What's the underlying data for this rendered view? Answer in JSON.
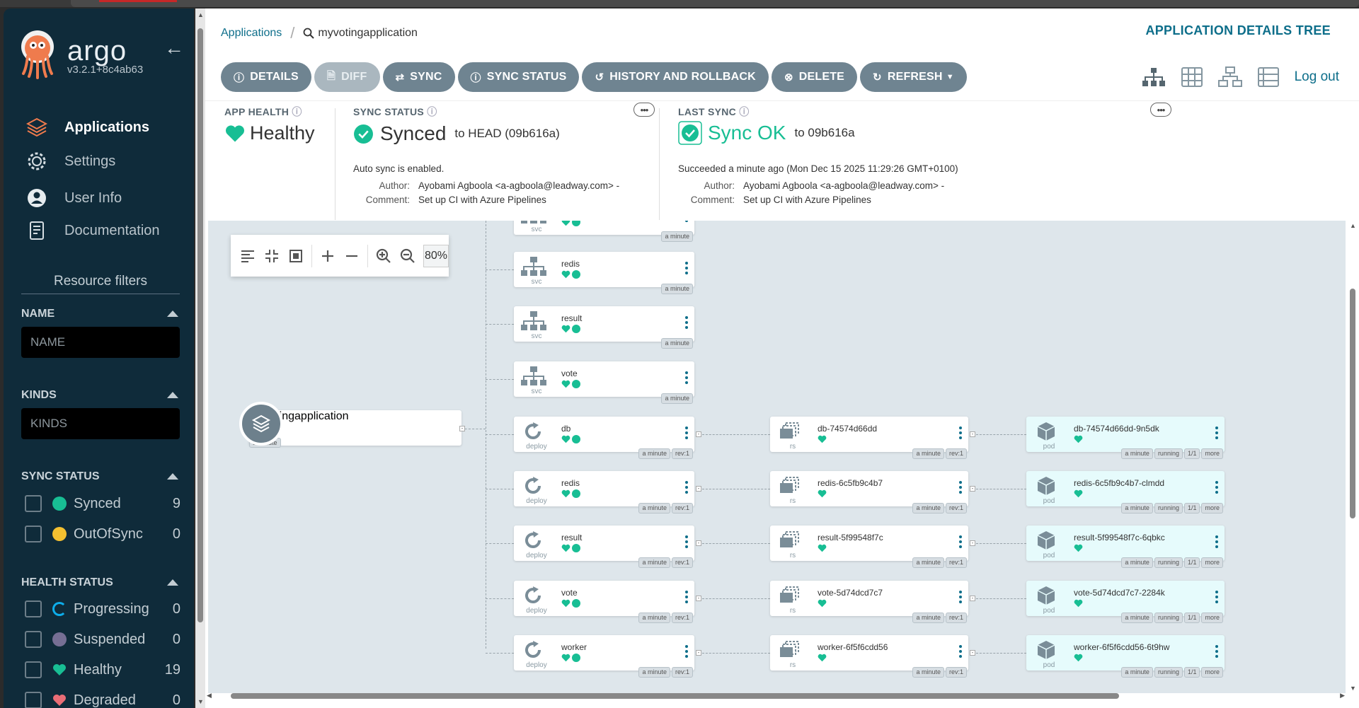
{
  "sidebar": {
    "logo_text": "argo",
    "version": "v3.2.1+8c4ab63",
    "nav": [
      {
        "label": "Applications"
      },
      {
        "label": "Settings"
      },
      {
        "label": "User Info"
      },
      {
        "label": "Documentation"
      }
    ],
    "resource_filters_title": "Resource filters",
    "name_section": {
      "title": "NAME",
      "placeholder": "NAME"
    },
    "kinds_section": {
      "title": "KINDS",
      "placeholder": "KINDS"
    },
    "sync_status": {
      "title": "SYNC STATUS",
      "items": [
        {
          "label": "Synced",
          "count": "9",
          "color": "#18be94"
        },
        {
          "label": "OutOfSync",
          "count": "0",
          "color": "#f4c030"
        }
      ]
    },
    "health_status": {
      "title": "HEALTH STATUS",
      "items": [
        {
          "label": "Progressing",
          "count": "0",
          "color": "#0dadea"
        },
        {
          "label": "Suspended",
          "count": "0",
          "color": "#766f94"
        },
        {
          "label": "Healthy",
          "count": "19",
          "color": "#18be94"
        },
        {
          "label": "Degraded",
          "count": "0",
          "color": "#e96d76"
        }
      ]
    }
  },
  "header": {
    "breadcrumb_root": "Applications",
    "breadcrumb_current": "myvotingapplication",
    "title": "APPLICATION DETAILS TREE",
    "logout": "Log out"
  },
  "toolbar": {
    "details": "DETAILS",
    "diff": "DIFF",
    "sync": "SYNC",
    "sync_status": "SYNC STATUS",
    "history": "HISTORY AND ROLLBACK",
    "delete": "DELETE",
    "refresh": "REFRESH"
  },
  "status": {
    "app_health_label": "APP HEALTH",
    "app_health_value": "Healthy",
    "sync_status_label": "SYNC STATUS",
    "sync_status_value": "Synced",
    "sync_target": "to HEAD (09b616a)",
    "auto_sync": "Auto sync is enabled.",
    "author_key": "Author:",
    "author_value": "Ayobami Agboola <a-agboola@leadway.com> -",
    "comment_key": "Comment:",
    "comment_value": "Set up CI with Azure Pipelines",
    "last_sync_label": "LAST SYNC",
    "last_sync_value": "Sync OK",
    "last_sync_target": "to 09b616a",
    "last_sync_time": "Succeeded a minute ago (Mon Dec 15 2025 11:29:26 GMT+0100)",
    "last_author_value": "Ayobami Agboola <a-agboola@leadway.com> -",
    "last_comment_value": "Set up CI with Azure Pipelines"
  },
  "graph": {
    "zoom": "80%",
    "app_node": {
      "name": "myvotingapplication",
      "age": "a minute"
    },
    "svc_nodes": [
      {
        "name": "",
        "type": "svc",
        "age": "a minute"
      },
      {
        "name": "redis",
        "type": "svc",
        "age": "a minute"
      },
      {
        "name": "result",
        "type": "svc",
        "age": "a minute"
      },
      {
        "name": "vote",
        "type": "svc",
        "age": "a minute"
      }
    ],
    "deploy_nodes": [
      {
        "name": "db",
        "type": "deploy",
        "age": "a minute",
        "rev": "rev:1"
      },
      {
        "name": "redis",
        "type": "deploy",
        "age": "a minute",
        "rev": "rev:1"
      },
      {
        "name": "result",
        "type": "deploy",
        "age": "a minute",
        "rev": "rev:1"
      },
      {
        "name": "vote",
        "type": "deploy",
        "age": "a minute",
        "rev": "rev:1"
      },
      {
        "name": "worker",
        "type": "deploy",
        "age": "a minute",
        "rev": "rev:1"
      }
    ],
    "rs_nodes": [
      {
        "name": "db-74574d66dd",
        "type": "rs",
        "age": "a minute",
        "rev": "rev:1"
      },
      {
        "name": "redis-6c5fb9c4b7",
        "type": "rs",
        "age": "a minute",
        "rev": "rev:1"
      },
      {
        "name": "result-5f99548f7c",
        "type": "rs",
        "age": "a minute",
        "rev": "rev:1"
      },
      {
        "name": "vote-5d74dcd7c7",
        "type": "rs",
        "age": "a minute",
        "rev": "rev:1"
      },
      {
        "name": "worker-6f5f6cdd56",
        "type": "rs",
        "age": "a minute",
        "rev": "rev:1"
      }
    ],
    "pod_nodes": [
      {
        "name": "db-74574d66dd-9n5dk",
        "type": "pod",
        "age": "a minute",
        "state": "running",
        "ready": "1/1",
        "more": "more"
      },
      {
        "name": "redis-6c5fb9c4b7-clmdd",
        "type": "pod",
        "age": "a minute",
        "state": "running",
        "ready": "1/1",
        "more": "more"
      },
      {
        "name": "result-5f99548f7c-6qbkc",
        "type": "pod",
        "age": "a minute",
        "state": "running",
        "ready": "1/1",
        "more": "more"
      },
      {
        "name": "vote-5d74dcd7c7-2284k",
        "type": "pod",
        "age": "a minute",
        "state": "running",
        "ready": "1/1",
        "more": "more"
      },
      {
        "name": "worker-6f5f6cdd56-6t9hw",
        "type": "pod",
        "age": "a minute",
        "state": "running",
        "ready": "1/1",
        "more": "more"
      }
    ]
  },
  "colors": {
    "sidebar_bg": "#0f2b3a",
    "accent": "#0d6e8a",
    "healthy": "#18be94",
    "button": "#6f8491",
    "graph_bg": "#dee6eb"
  }
}
